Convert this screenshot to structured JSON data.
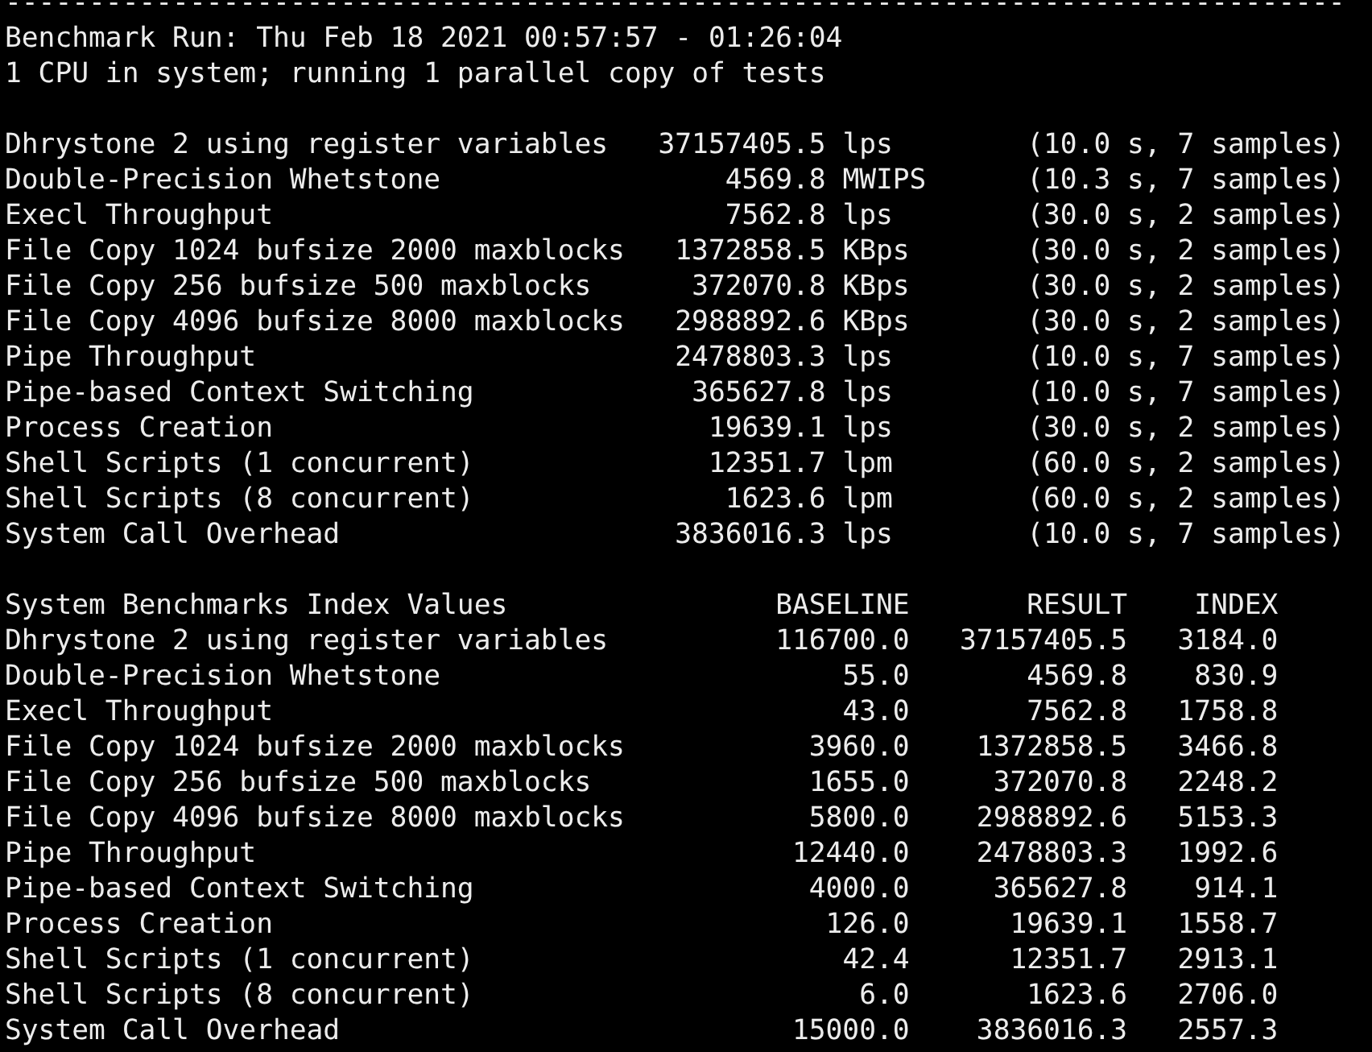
{
  "separator": "--------------------------------------------------------------------------------",
  "header": [
    "Benchmark Run: Thu Feb 18 2021 00:57:57 - 01:26:04",
    "1 CPU in system; running 1 parallel copy of tests"
  ],
  "results": [
    {
      "name": "Dhrystone 2 using register variables",
      "value": "37157405.5",
      "unit": "lps",
      "detail": "(10.0 s, 7 samples)"
    },
    {
      "name": "Double-Precision Whetstone",
      "value": "4569.8",
      "unit": "MWIPS",
      "detail": "(10.3 s, 7 samples)"
    },
    {
      "name": "Execl Throughput",
      "value": "7562.8",
      "unit": "lps",
      "detail": "(30.0 s, 2 samples)"
    },
    {
      "name": "File Copy 1024 bufsize 2000 maxblocks",
      "value": "1372858.5",
      "unit": "KBps",
      "detail": "(30.0 s, 2 samples)"
    },
    {
      "name": "File Copy 256 bufsize 500 maxblocks",
      "value": "372070.8",
      "unit": "KBps",
      "detail": "(30.0 s, 2 samples)"
    },
    {
      "name": "File Copy 4096 bufsize 8000 maxblocks",
      "value": "2988892.6",
      "unit": "KBps",
      "detail": "(30.0 s, 2 samples)"
    },
    {
      "name": "Pipe Throughput",
      "value": "2478803.3",
      "unit": "lps",
      "detail": "(10.0 s, 7 samples)"
    },
    {
      "name": "Pipe-based Context Switching",
      "value": "365627.8",
      "unit": "lps",
      "detail": "(10.0 s, 7 samples)"
    },
    {
      "name": "Process Creation",
      "value": "19639.1",
      "unit": "lps",
      "detail": "(30.0 s, 2 samples)"
    },
    {
      "name": "Shell Scripts (1 concurrent)",
      "value": "12351.7",
      "unit": "lpm",
      "detail": "(60.0 s, 2 samples)"
    },
    {
      "name": "Shell Scripts (8 concurrent)",
      "value": "1623.6",
      "unit": "lpm",
      "detail": "(60.0 s, 2 samples)"
    },
    {
      "name": "System Call Overhead",
      "value": "3836016.3",
      "unit": "lps",
      "detail": "(10.0 s, 7 samples)"
    }
  ],
  "index": {
    "columns": [
      "System Benchmarks Index Values",
      "BASELINE",
      "RESULT",
      "INDEX"
    ],
    "rows": [
      [
        "Dhrystone 2 using register variables",
        "116700.0",
        "37157405.5",
        "3184.0"
      ],
      [
        "Double-Precision Whetstone",
        "55.0",
        "4569.8",
        "830.9"
      ],
      [
        "Execl Throughput",
        "43.0",
        "7562.8",
        "1758.8"
      ],
      [
        "File Copy 1024 bufsize 2000 maxblocks",
        "3960.0",
        "1372858.5",
        "3466.8"
      ],
      [
        "File Copy 256 bufsize 500 maxblocks",
        "1655.0",
        "372070.8",
        "2248.2"
      ],
      [
        "File Copy 4096 bufsize 8000 maxblocks",
        "5800.0",
        "2988892.6",
        "5153.3"
      ],
      [
        "Pipe Throughput",
        "12440.0",
        "2478803.3",
        "1992.6"
      ],
      [
        "Pipe-based Context Switching",
        "4000.0",
        "365627.8",
        "914.1"
      ],
      [
        "Process Creation",
        "126.0",
        "19639.1",
        "1558.7"
      ],
      [
        "Shell Scripts (1 concurrent)",
        "42.4",
        "12351.7",
        "2913.1"
      ],
      [
        "Shell Scripts (8 concurrent)",
        "6.0",
        "1623.6",
        "2706.0"
      ],
      [
        "System Call Overhead",
        "15000.0",
        "3836016.3",
        "2557.3"
      ]
    ]
  }
}
